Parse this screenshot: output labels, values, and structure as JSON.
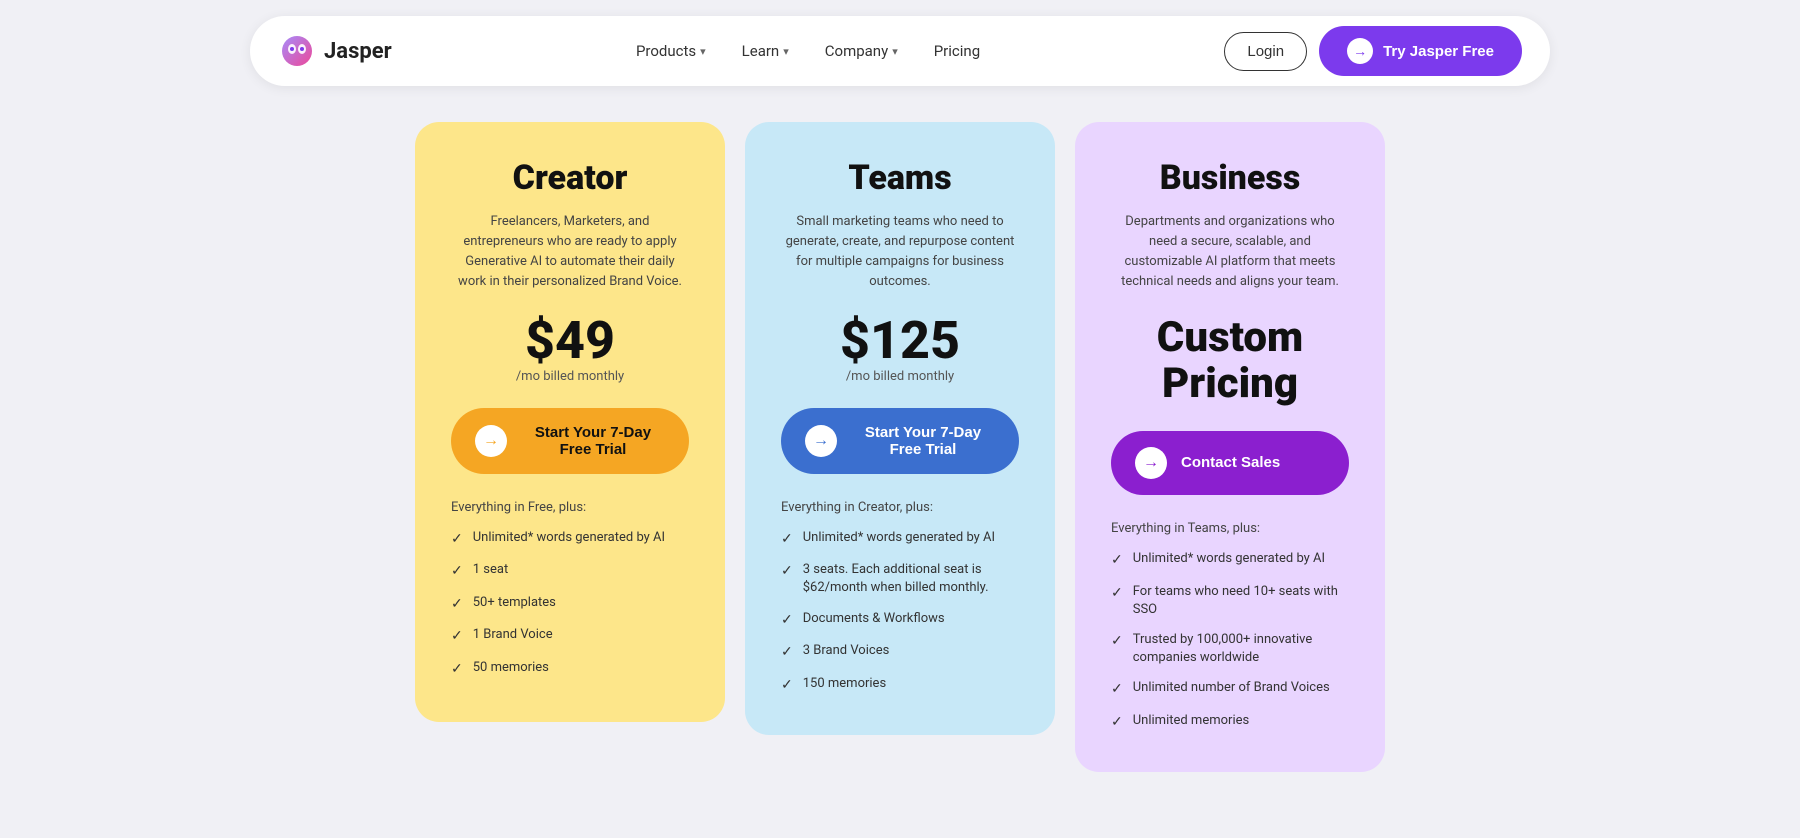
{
  "navbar": {
    "logo_text": "Jasper",
    "nav_items": [
      {
        "label": "Products",
        "has_chevron": true
      },
      {
        "label": "Learn",
        "has_chevron": true
      },
      {
        "label": "Company",
        "has_chevron": true
      },
      {
        "label": "Pricing",
        "has_chevron": false
      }
    ],
    "login_label": "Login",
    "try_label": "Try Jasper Free"
  },
  "pricing": {
    "cards": [
      {
        "id": "creator",
        "title": "Creator",
        "desc": "Freelancers, Marketers, and entrepreneurs who are ready to apply Generative AI to automate their daily work in their personalized Brand Voice.",
        "price": "$49",
        "price_sub": "/mo billed monthly",
        "btn_label": "Start Your 7-Day Free Trial",
        "features_header": "Everything in Free, plus:",
        "features": [
          "Unlimited* words generated by AI",
          "1 seat",
          "50+ templates",
          "1 Brand Voice",
          "50 memories"
        ]
      },
      {
        "id": "teams",
        "title": "Teams",
        "desc": "Small marketing teams who need to generate, create, and repurpose content for multiple campaigns for business outcomes.",
        "price": "$125",
        "price_sub": "/mo billed monthly",
        "btn_label": "Start Your 7-Day Free Trial",
        "features_header": "Everything in Creator, plus:",
        "features": [
          "Unlimited* words generated by AI",
          "3 seats. Each additional seat is $62/month when billed monthly.",
          "Documents & Workflows",
          "3 Brand Voices",
          "150 memories"
        ]
      },
      {
        "id": "business",
        "title": "Business",
        "desc": "Departments and organizations who need a secure, scalable, and customizable AI platform that meets technical needs and aligns your team.",
        "price": "Custom Pricing",
        "btn_label": "Contact Sales",
        "features_header": "Everything in Teams, plus:",
        "features": [
          "Unlimited* words generated by AI",
          "For teams who need 10+ seats with SSO",
          "Trusted by 100,000+ innovative companies worldwide",
          "Unlimited number of Brand Voices",
          "Unlimited memories"
        ]
      }
    ]
  }
}
